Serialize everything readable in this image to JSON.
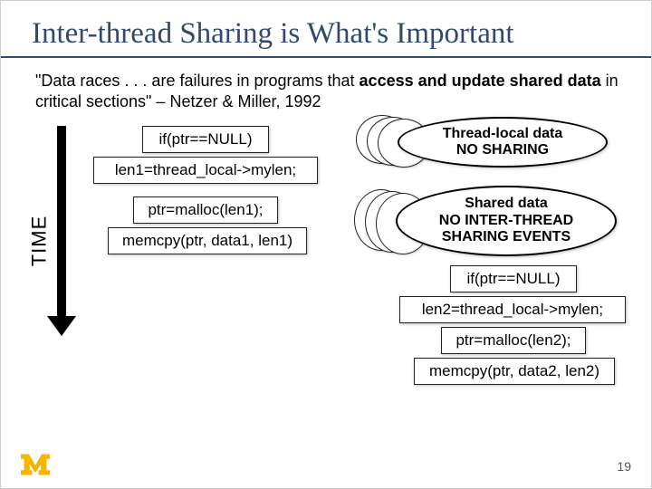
{
  "title": "Inter-thread Sharing is What's Important",
  "quote": {
    "p1": "\"Data races . . . are failures in programs that ",
    "b1": "access and update shared data",
    "p2": " in critical sections\" – Netzer & Miller, 1992"
  },
  "time_label": "TIME",
  "left_code": {
    "l1": "if(ptr==NULL)",
    "l2": "len1=thread_local->mylen;",
    "l3": "ptr=malloc(len1);",
    "l4": "memcpy(ptr, data1, len1)"
  },
  "ellipse1": {
    "line1": "Thread-local data",
    "line2": "NO SHARING"
  },
  "ellipse2": {
    "line1": "Shared data",
    "line2": "NO INTER-THREAD",
    "line3": "SHARING EVENTS"
  },
  "right_code": {
    "r1": "if(ptr==NULL)",
    "r2": "len2=thread_local->mylen;",
    "r3": "ptr=malloc(len2);",
    "r4": "memcpy(ptr, data2, len2)"
  },
  "page_number": "19"
}
